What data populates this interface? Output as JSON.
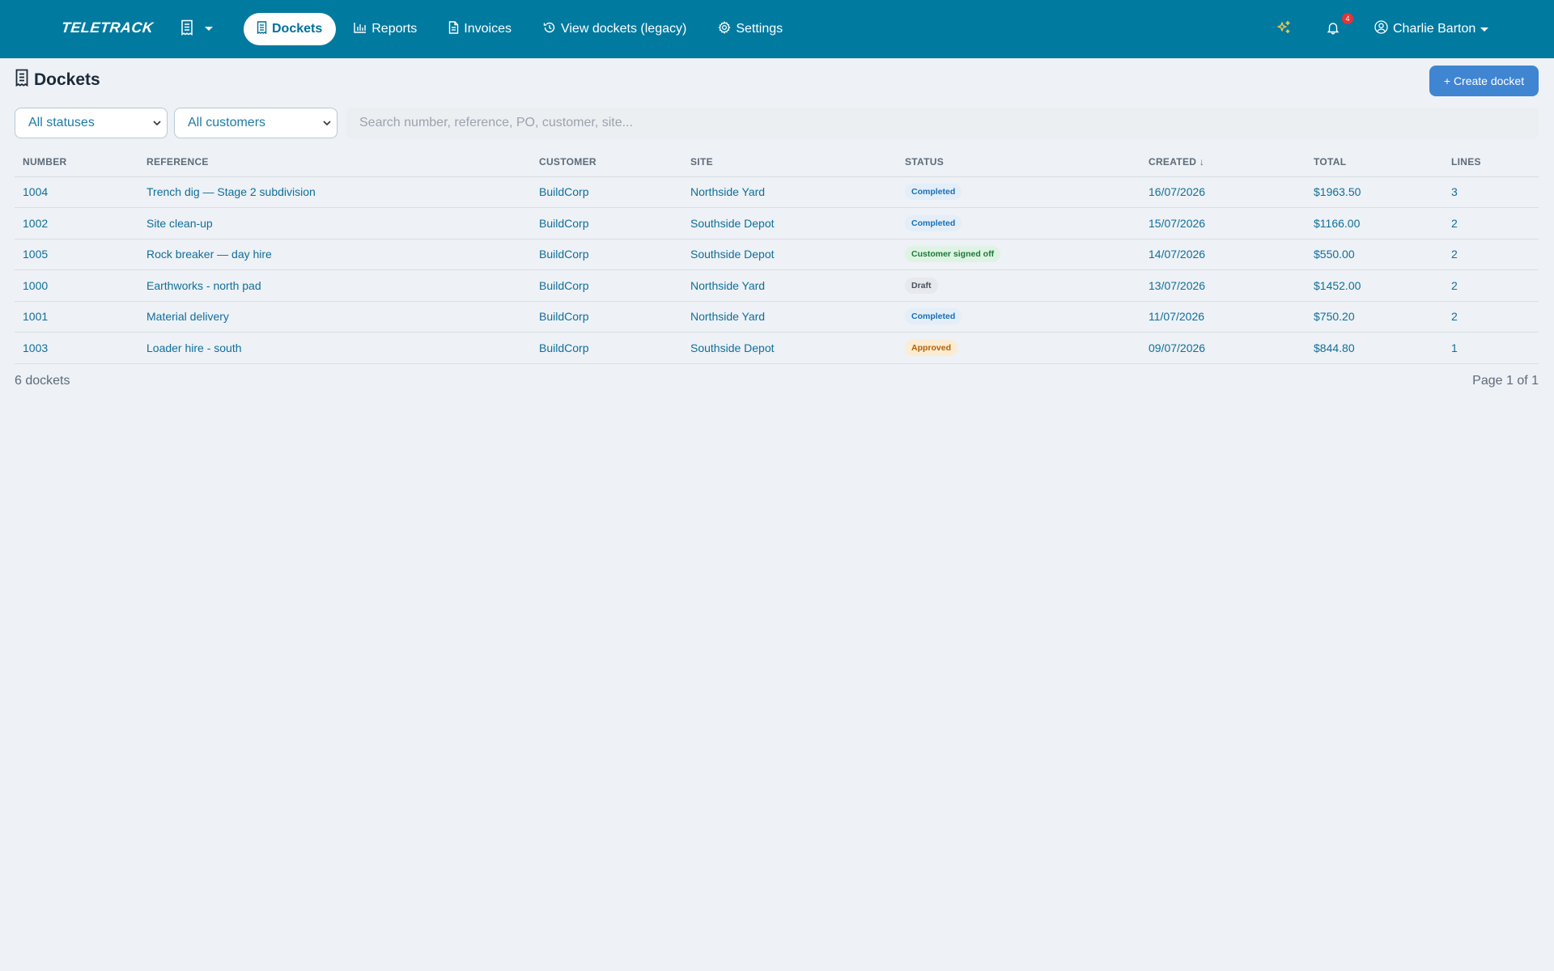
{
  "app": {
    "logo_text": "TELETRACK"
  },
  "nav": {
    "items": [
      {
        "label": "Dockets",
        "icon": "receipt-icon",
        "active": true
      },
      {
        "label": "Reports",
        "icon": "bar-chart-icon",
        "active": false
      },
      {
        "label": "Invoices",
        "icon": "file-text-icon",
        "active": false
      },
      {
        "label": "View dockets (legacy)",
        "icon": "history-icon",
        "active": false
      },
      {
        "label": "Settings",
        "icon": "gear-icon",
        "active": false
      }
    ],
    "notification_count": "4",
    "user_name": "Charlie Barton"
  },
  "page": {
    "title": "Dockets",
    "create_button_label": "+ Create docket"
  },
  "filters": {
    "status_selected": "All statuses",
    "customer_selected": "All customers",
    "search_placeholder": "Search number, reference, PO, customer, site..."
  },
  "table": {
    "columns": [
      "NUMBER",
      "REFERENCE",
      "CUSTOMER",
      "SITE",
      "STATUS",
      "CREATED ↓",
      "TOTAL",
      "LINES"
    ],
    "rows": [
      {
        "number": "1004",
        "reference": "Trench dig — Stage 2 subdivision",
        "customer": "BuildCorp",
        "site": "Northside Yard",
        "status": "Completed",
        "status_kind": "completed",
        "created": "16/07/2026",
        "total": "$1963.50",
        "lines": "3"
      },
      {
        "number": "1002",
        "reference": "Site clean-up",
        "customer": "BuildCorp",
        "site": "Southside Depot",
        "status": "Completed",
        "status_kind": "completed",
        "created": "15/07/2026",
        "total": "$1166.00",
        "lines": "2"
      },
      {
        "number": "1005",
        "reference": "Rock breaker — day hire",
        "customer": "BuildCorp",
        "site": "Southside Depot",
        "status": "Customer signed off",
        "status_kind": "signed",
        "created": "14/07/2026",
        "total": "$550.00",
        "lines": "2"
      },
      {
        "number": "1000",
        "reference": "Earthworks - north pad",
        "customer": "BuildCorp",
        "site": "Northside Yard",
        "status": "Draft",
        "status_kind": "draft",
        "created": "13/07/2026",
        "total": "$1452.00",
        "lines": "2"
      },
      {
        "number": "1001",
        "reference": "Material delivery",
        "customer": "BuildCorp",
        "site": "Northside Yard",
        "status": "Completed",
        "status_kind": "completed",
        "created": "11/07/2026",
        "total": "$750.20",
        "lines": "2"
      },
      {
        "number": "1003",
        "reference": "Loader hire - south",
        "customer": "BuildCorp",
        "site": "Southside Depot",
        "status": "Approved",
        "status_kind": "approved",
        "created": "09/07/2026",
        "total": "$844.80",
        "lines": "1"
      }
    ]
  },
  "footer": {
    "count_text": "6 dockets",
    "page_text": "Page 1 of 1"
  },
  "colors": {
    "nav_bg": "#017aa0",
    "accent": "#3f85d2",
    "link": "#0f6f9b",
    "sparkle": "#f2c94c",
    "badge_red": "#e0353b"
  }
}
